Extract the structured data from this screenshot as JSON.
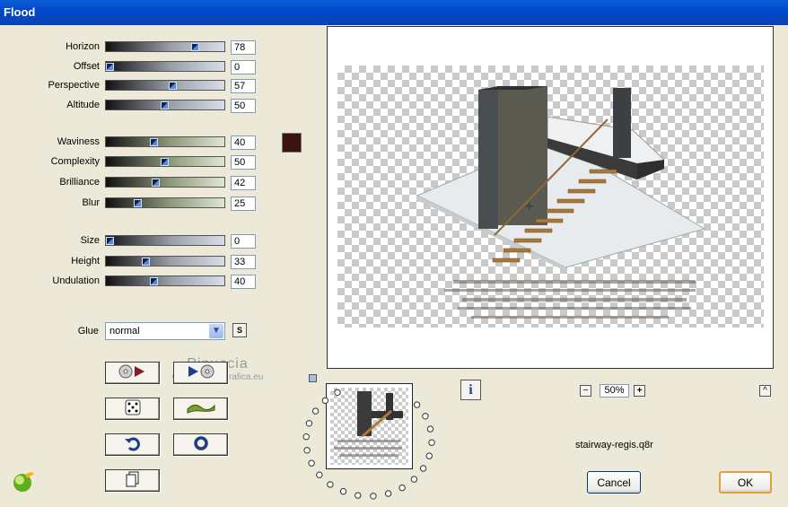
{
  "window": {
    "title": "Flood"
  },
  "sliders": [
    {
      "label": "Horizon",
      "value": "78",
      "level": 0.78,
      "style": "grey"
    },
    {
      "label": "Offset",
      "value": "0",
      "level": 0.0,
      "style": "grey"
    },
    {
      "label": "Perspective",
      "value": "57",
      "level": 0.57,
      "style": "grey"
    },
    {
      "label": "Altitude",
      "value": "50",
      "level": 0.5,
      "style": "grey"
    },
    {
      "label": "Waviness",
      "value": "40",
      "level": 0.4,
      "style": "green"
    },
    {
      "label": "Complexity",
      "value": "50",
      "level": 0.5,
      "style": "green"
    },
    {
      "label": "Brilliance",
      "value": "42",
      "level": 0.42,
      "style": "green"
    },
    {
      "label": "Blur",
      "value": "25",
      "level": 0.25,
      "style": "green"
    },
    {
      "label": "Size",
      "value": "0",
      "level": 0.0,
      "style": "grey"
    },
    {
      "label": "Height",
      "value": "33",
      "level": 0.33,
      "style": "grey"
    },
    {
      "label": "Undulation",
      "value": "40",
      "level": 0.4,
      "style": "grey"
    }
  ],
  "color_swatch": "#3b140f",
  "glue": {
    "label": "Glue",
    "selected": "normal",
    "s_button": "S"
  },
  "watermark": {
    "line1": "Pinuccia",
    "line2": "www.maddregrafica.eu"
  },
  "icons": {
    "reset": "cd-arrow-icon",
    "play": "play-cd-icon",
    "random": "dice-icon",
    "wave": "wave-icon",
    "undo": "undo-icon",
    "ring": "ring-icon",
    "copy": "copy-icon",
    "logo": "app-logo-icon",
    "info": "info-icon"
  },
  "zoom": {
    "minus": "−",
    "value": "50%",
    "plus": "+",
    "collapse": "^"
  },
  "preset_name": "stairway-regis.q8r",
  "buttons": {
    "cancel": "Cancel",
    "ok": "OK"
  }
}
